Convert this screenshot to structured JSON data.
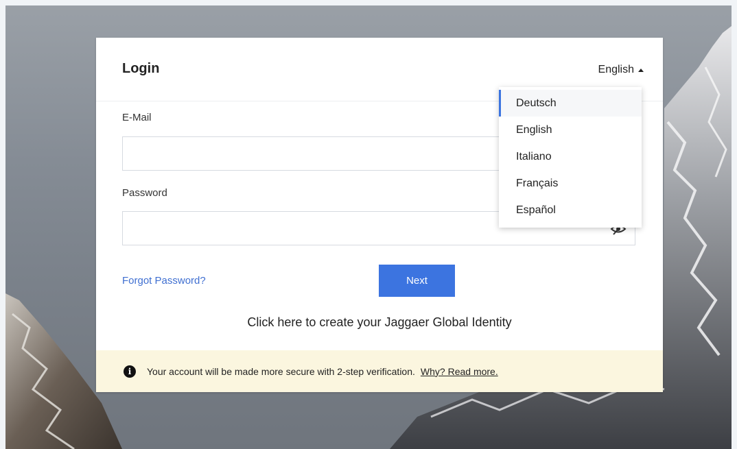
{
  "login": {
    "title": "Login",
    "language_current": "English",
    "email_label": "E-Mail",
    "email_value": "",
    "password_label": "Password",
    "password_value": "",
    "forgot_label": "Forgot Password?",
    "next_label": "Next",
    "create_identity_label": "Click here to create your Jaggaer Global Identity"
  },
  "language_menu": {
    "items": [
      "Deutsch",
      "English",
      "Italiano",
      "Français",
      "Español"
    ],
    "highlighted": "Deutsch"
  },
  "notice": {
    "text": "Your account will be made more secure with 2-step verification.",
    "link": "Why? Read more.",
    "icon": "info-icon"
  },
  "colors": {
    "accent": "#3c74e0",
    "link": "#3f6fd1",
    "notice_bg": "#fbf6df"
  }
}
